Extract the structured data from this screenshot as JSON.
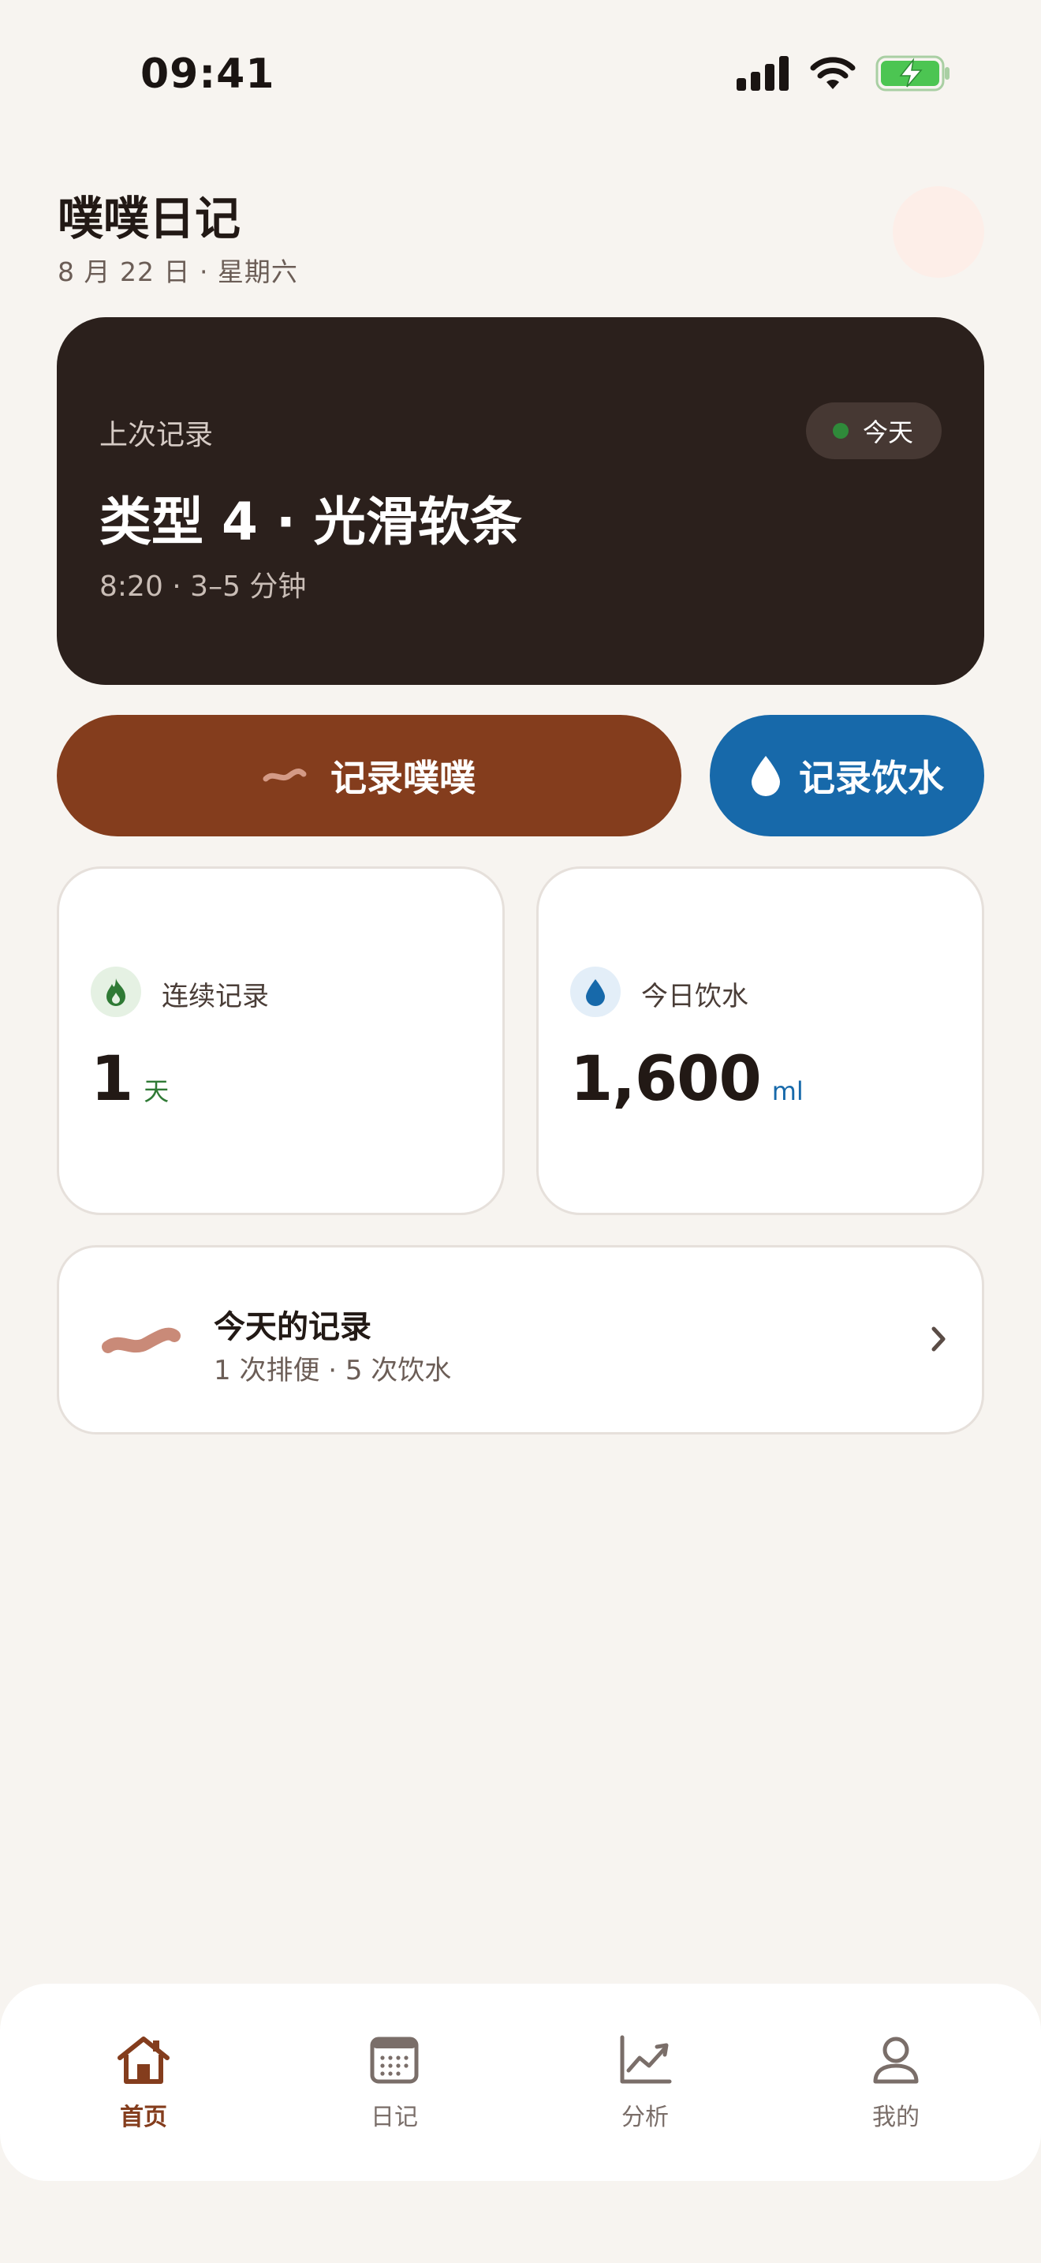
{
  "status_bar": {
    "time": "09:41"
  },
  "header": {
    "title": "噗噗日记",
    "date": "8 月 22 日 · 星期六"
  },
  "last_record": {
    "label": "上次记录",
    "badge": "今天",
    "title": "类型 4 · 光滑软条",
    "meta": "8:20 · 3–5 分钟"
  },
  "actions": {
    "poop_label": "记录噗噗",
    "water_label": "记录饮水"
  },
  "stats": {
    "streak": {
      "name": "连续记录",
      "value": "1",
      "unit": "天"
    },
    "water": {
      "name": "今日饮水",
      "value": "1,600",
      "unit": "ml"
    }
  },
  "today_records": {
    "title": "今天的记录",
    "subtitle": "1 次排便 · 5 次饮水"
  },
  "nav": {
    "home": "首页",
    "diary": "日记",
    "analysis": "分析",
    "me": "我的"
  },
  "colors": {
    "brand_brown": "#843d1d",
    "water_blue": "#1769aa",
    "streak_green": "#2f7a35",
    "card_dark": "#2b201c",
    "background": "#f7f4f0"
  }
}
